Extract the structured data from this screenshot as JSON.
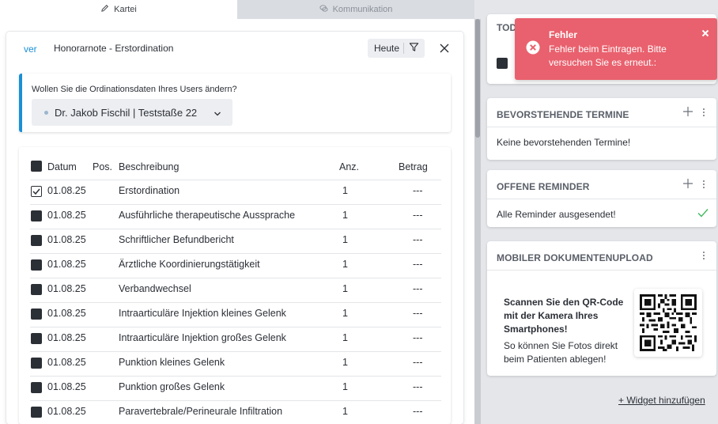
{
  "tabs": [
    {
      "label": "Kartei",
      "icon": "pencil-icon"
    },
    {
      "label": "Kommunikation",
      "icon": "chat-icon"
    }
  ],
  "card": {
    "back_label": "ver",
    "title": "Honorarnote - Erstordination",
    "date_filter": "Heute"
  },
  "info": {
    "question": "Wollen Sie die Ordinationsdaten Ihres Users ändern?",
    "selected_user": "Dr. Jakob Fischil | Teststaße 22"
  },
  "table": {
    "headers": {
      "datum": "Datum",
      "pos": "Pos.",
      "beschreibung": "Beschreibung",
      "anz": "Anz.",
      "betrag": "Betrag"
    },
    "rows": [
      {
        "checked": true,
        "datum": "01.08.25",
        "pos": "",
        "beschreibung": "Erstordination",
        "anz": "1",
        "betrag": "---"
      },
      {
        "checked": false,
        "datum": "01.08.25",
        "pos": "",
        "beschreibung": "Ausführliche therapeutische Aussprache",
        "anz": "1",
        "betrag": "---"
      },
      {
        "checked": false,
        "datum": "01.08.25",
        "pos": "",
        "beschreibung": "Schriftlicher Befundbericht",
        "anz": "1",
        "betrag": "---"
      },
      {
        "checked": false,
        "datum": "01.08.25",
        "pos": "",
        "beschreibung": "Ärztliche Koordinierungstätigkeit",
        "anz": "1",
        "betrag": "---"
      },
      {
        "checked": false,
        "datum": "01.08.25",
        "pos": "",
        "beschreibung": "Verbandwechsel",
        "anz": "1",
        "betrag": "---"
      },
      {
        "checked": false,
        "datum": "01.08.25",
        "pos": "",
        "beschreibung": "Intraarticuläre Injektion kleines Gelenk",
        "anz": "1",
        "betrag": "---"
      },
      {
        "checked": false,
        "datum": "01.08.25",
        "pos": "",
        "beschreibung": "Intraarticuläre Injektion großes Gelenk",
        "anz": "1",
        "betrag": "---"
      },
      {
        "checked": false,
        "datum": "01.08.25",
        "pos": "",
        "beschreibung": "Punktion kleines Gelenk",
        "anz": "1",
        "betrag": "---"
      },
      {
        "checked": false,
        "datum": "01.08.25",
        "pos": "",
        "beschreibung": "Punktion großes Gelenk",
        "anz": "1",
        "betrag": "---"
      },
      {
        "checked": false,
        "datum": "01.08.25",
        "pos": "",
        "beschreibung": "Paravertebrale/Perineurale Infiltration",
        "anz": "1",
        "betrag": "---"
      }
    ]
  },
  "widgets": {
    "todo": {
      "title": "TOD"
    },
    "termine": {
      "title": "BEVORSTEHENDE TERMINE",
      "body": "Keine bevorstehenden Termine!"
    },
    "reminder": {
      "title": "OFFENE REMINDER",
      "body": "Alle Reminder ausgesendet!"
    },
    "upload": {
      "title": "MOBILER DOKUMENTENUPLOAD",
      "text_bold": "Scannen Sie den QR-Code mit der Kamera Ihres Smartphones!",
      "text": "So können Sie Fotos direkt beim Patienten ablegen!"
    },
    "add_label": "+ Widget hinzufügen"
  },
  "toast": {
    "title": "Fehler",
    "message": "Fehler beim Eintragen. Bitte versuchen Sie es erneut.:"
  },
  "colors": {
    "accent": "#1a8fd6",
    "error": "#e9616e",
    "success": "#3cb95a"
  }
}
